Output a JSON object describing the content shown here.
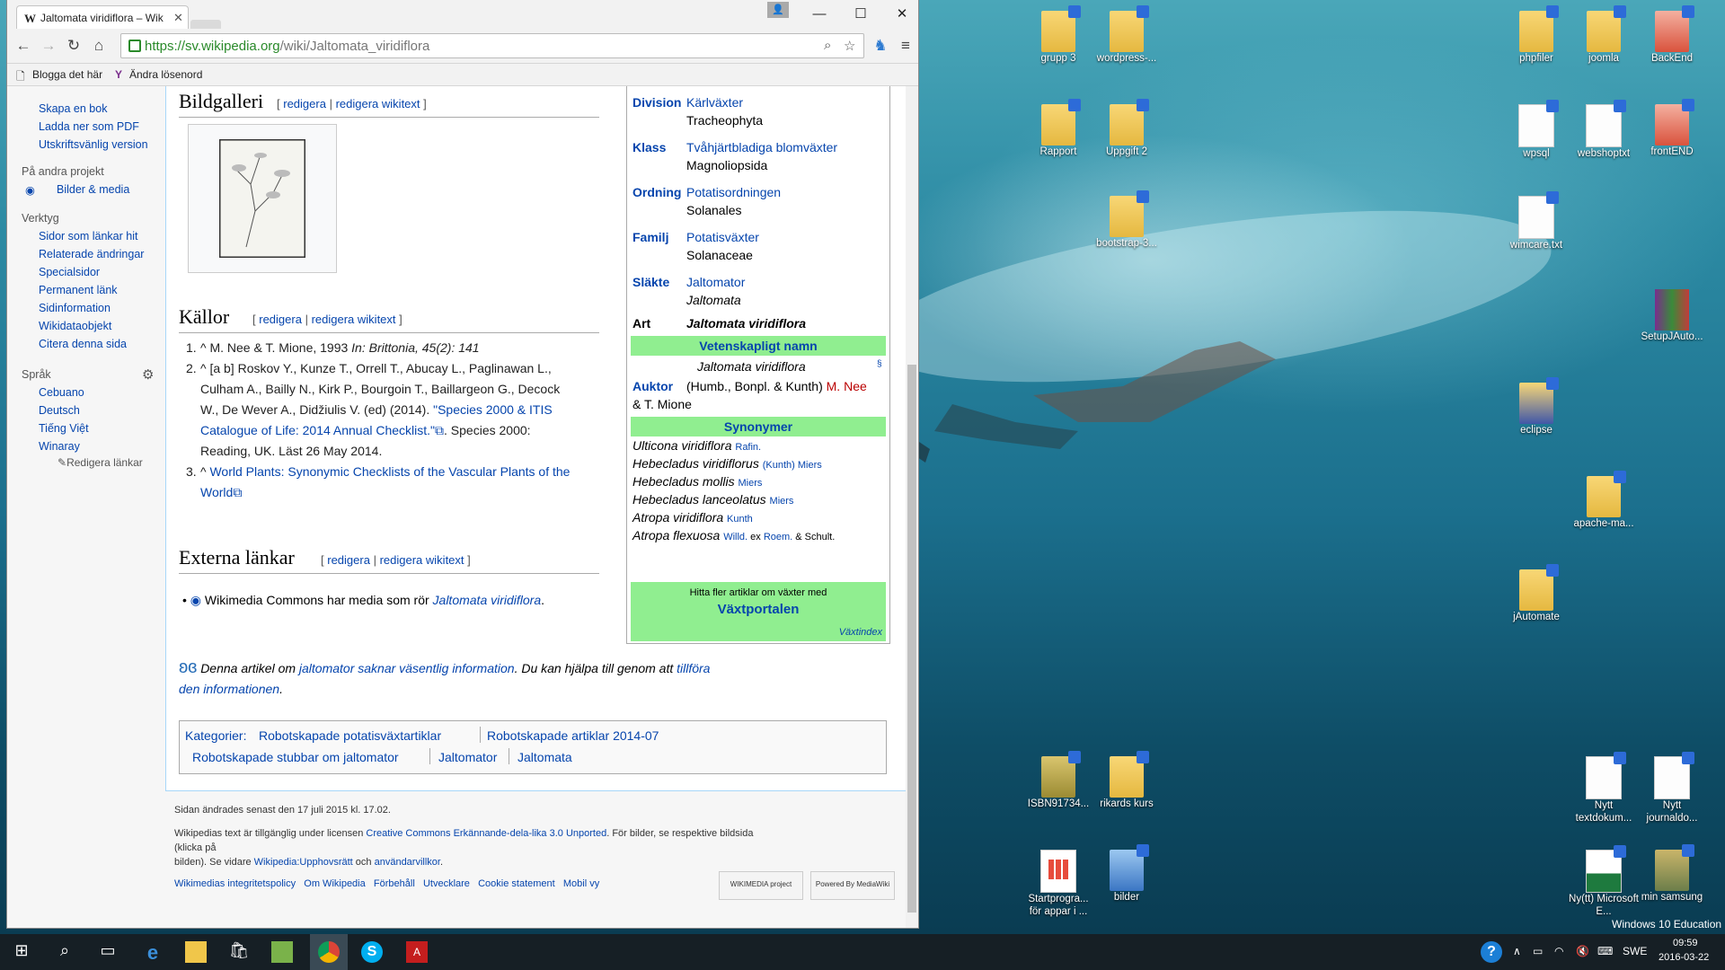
{
  "browser": {
    "tab_title": "Jaltomata viridiflora – Wik",
    "url_host": "https://sv.wikipedia.org",
    "url_path": "/wiki/Jaltomata_viridiflora",
    "bookmarks": [
      "Blogga det här",
      "Ändra lösenord"
    ]
  },
  "sidebar": {
    "tools_top": [
      "Skapa en bok",
      "Ladda ner som PDF",
      "Utskriftsvänlig version"
    ],
    "other_projects_head": "På andra projekt",
    "other_projects": [
      "Bilder & media"
    ],
    "verktyg_head": "Verktyg",
    "verktyg": [
      "Sidor som länkar hit",
      "Relaterade ändringar",
      "Specialsidor",
      "Permanent länk",
      "Sidinformation",
      "Wikidataobjekt",
      "Citera denna sida"
    ],
    "sprak_head": "Språk",
    "languages": [
      "Cebuano",
      "Deutsch",
      "Tiếng Việt",
      "Winaray"
    ],
    "edit_links": "Redigera länkar"
  },
  "article": {
    "gallery_heading": "Bildgalleri",
    "sources_heading": "Källor",
    "external_heading": "Externa länkar",
    "edit_open": "[",
    "edit": "redigera",
    "sep": "|",
    "edit_wiki": "redigera wikitext",
    "edit_close": "]",
    "ref1": "^ M. Nee & T. Mione, 1993 ",
    "ref1_italic": "In: Brittonia, 45(2): 141",
    "ref2_a": "^ [a b] Roskov Y., Kunze T., Orrell T., Abucay L., Paglinawan L.,",
    "ref2_b": "Culham A., Bailly N., Kirk P., Bourgoin T., Baillargeon G., Decock",
    "ref2_c": "W., De Wever A., Didžiulis V. (ed) (2014). ",
    "ref2_link1": "\"Species 2000 & ITIS",
    "ref2_link2": "Catalogue of Life: 2014 Annual Checklist.\"",
    "ref2_d": ". Species 2000:",
    "ref2_e": "Reading, UK. Läst 26 May 2014.",
    "ref3_a": "^ ",
    "ref3_link1": "World Plants: Synonymic Checklists of the Vascular Plants of the",
    "ref3_link2": "World",
    "external_item": "Wikimedia Commons har media som rör ",
    "external_item_link": "Jaltomata viridiflora",
    "stub_a": "Denna artikel om ",
    "stub_b": "jaltomator",
    "stub_c": " saknar väsentlig information",
    "stub_d": ". Du kan hjälpa till genom att ",
    "stub_e": "tillföra den",
    "stub_f": "informationen",
    "categories_label": "Kategorier:",
    "categories": [
      "Robotskapade potatisväxtartiklar",
      "Robotskapade artiklar 2014-07",
      "Robotskapade stubbar om jaltomator",
      "Jaltomator",
      "Jaltomata"
    ]
  },
  "infobox": {
    "rows": [
      {
        "key": "Division",
        "link": "Kärlväxter",
        "sci": "Tracheophyta"
      },
      {
        "key": "Klass",
        "link": "Tvåhjärtbladiga blomväxter",
        "sci": "Magnoliopsida"
      },
      {
        "key": "Ordning",
        "link": "Potatisordningen",
        "sci": "Solanales"
      },
      {
        "key": "Familj",
        "link": "Potatisväxter",
        "sci": "Solanaceae"
      },
      {
        "key": "Släkte",
        "link": "Jaltomator",
        "sci": "Jaltomata"
      }
    ],
    "art_key": "Art",
    "art_val": "Jaltomata viridiflora",
    "sci_name_head": "Vetenskapligt namn",
    "sci_name": "Jaltomata viridiflora",
    "sci_marker": "§",
    "auktor_key": "Auktor",
    "auktor_a": "(Humb., Bonpl. & Kunth) ",
    "auktor_b": "M. Nee",
    "auktor_c": "& T. Mione",
    "synonyms_head": "Synonymer",
    "syn1": "Ulticona viridiflora",
    "syn1_auth": "Rafin.",
    "syn2": "Hebecladus viridiflorus",
    "syn2_auth": "(Kunth) Miers",
    "syn3": "Hebecladus mollis",
    "syn3_auth": "Miers",
    "syn4": "Hebecladus lanceolatus",
    "syn4_auth": "Miers",
    "syn5": "Atropa viridiflora",
    "syn5_auth": "Kunth",
    "syn6": "Atropa flexuosa",
    "syn6_auth_a": "Willd.",
    "syn6_ex": " ex ",
    "syn6_auth_b": "Roem.",
    "syn6_tail": " & Schult.",
    "portal_text": "Hitta fler artiklar om växter med",
    "portal_link": "Växtportalen",
    "portal_index": "Växtindex"
  },
  "footer": {
    "modified": "Sidan ändrades senast den 17 juli 2015 kl. 17.02.",
    "license_a": "Wikipedias text är tillgänglig under licensen ",
    "license_link": "Creative Commons Erkännande-dela-lika 3.0 Unported",
    "license_b": ". För bilder, se respektive bildsida (klicka på",
    "license_c": "bilden). Se vidare ",
    "license_link2": "Wikipedia:Upphovsrätt",
    "license_d": " och ",
    "license_link3": "användarvillkor",
    "license_e": ".",
    "links": [
      "Wikimedias integritetspolicy",
      "Om Wikipedia",
      "Förbehåll",
      "Utvecklare",
      "Cookie statement",
      "Mobil vy"
    ],
    "wikimedia_badge": "WIKIMEDIA project",
    "mediawiki_badge": "Powered By MediaWiki"
  },
  "desktop": {
    "icons": [
      {
        "label": "grupp 3",
        "type": "folder"
      },
      {
        "label": "wordpress-...",
        "type": "folder"
      },
      {
        "label": "Rapport",
        "type": "folder"
      },
      {
        "label": "Uppgift 2",
        "type": "folder"
      },
      {
        "label": "bootstrap-3...",
        "type": "folder"
      },
      {
        "label": "ISBN91734...",
        "type": "folder"
      },
      {
        "label": "rikards kurs",
        "type": "folder"
      },
      {
        "label": "Startprogra... för appar i ...",
        "type": "app"
      },
      {
        "label": "bilder",
        "type": "folder"
      },
      {
        "label": "phpfiler",
        "type": "folder"
      },
      {
        "label": "joomla",
        "type": "folder"
      },
      {
        "label": "BackEnd",
        "type": "folder"
      },
      {
        "label": "wpsql",
        "type": "doc"
      },
      {
        "label": "webshoptxt",
        "type": "doc"
      },
      {
        "label": "frontEND",
        "type": "folder"
      },
      {
        "label": "wimcare.txt",
        "type": "doc"
      },
      {
        "label": "SetupJAuto...",
        "type": "app"
      },
      {
        "label": "eclipse",
        "type": "folder"
      },
      {
        "label": "apache-ma...",
        "type": "folder"
      },
      {
        "label": "jAutomate",
        "type": "folder"
      },
      {
        "label": "Nytt textdokum...",
        "type": "doc"
      },
      {
        "label": "Nytt journaldo...",
        "type": "doc"
      },
      {
        "label": "Ny(tt) Microsoft E...",
        "type": "doc"
      },
      {
        "label": "min samsung",
        "type": "folder"
      }
    ],
    "watermark": "Windows 10 Education"
  },
  "taskbar": {
    "lang": "SWE",
    "time": "09:59",
    "date": "2016-03-22"
  }
}
